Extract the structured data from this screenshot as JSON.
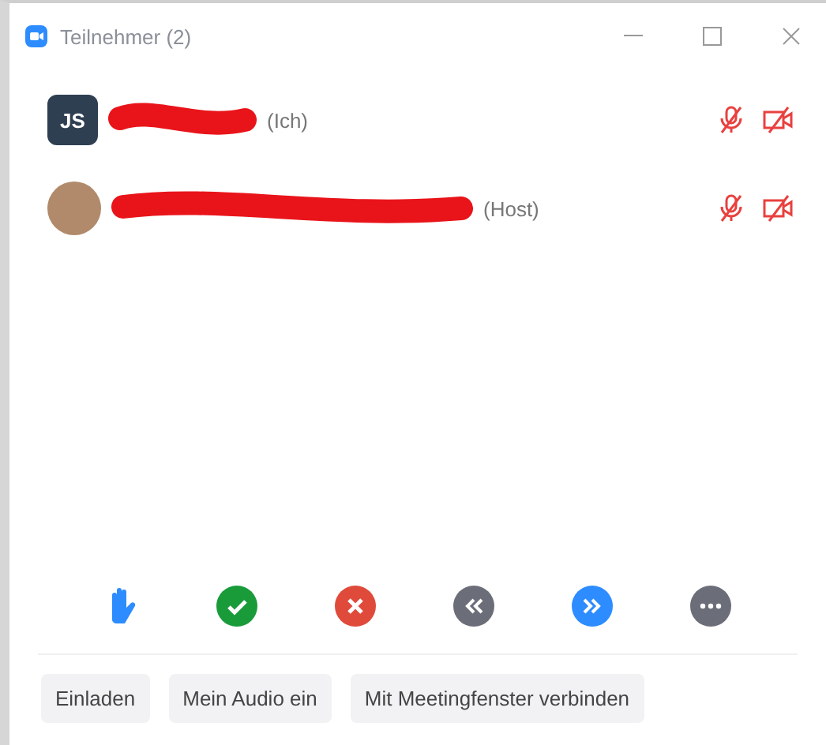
{
  "window": {
    "title": "Teilnehmer (2)"
  },
  "participants": [
    {
      "avatar": {
        "kind": "initials",
        "text": "JS"
      },
      "tag": "(Ich)",
      "redaction": {
        "kind": "short"
      },
      "audio_muted": true,
      "video_off": true
    },
    {
      "avatar": {
        "kind": "photo"
      },
      "tag": "(Host)",
      "redaction": {
        "kind": "long"
      },
      "audio_muted": true,
      "video_off": true
    }
  ],
  "reactions": [
    {
      "kind": "raise-hand"
    },
    {
      "kind": "yes"
    },
    {
      "kind": "no"
    },
    {
      "kind": "slower"
    },
    {
      "kind": "faster"
    },
    {
      "kind": "more"
    }
  ],
  "buttons": [
    "Einladen",
    "Mein Audio ein",
    "Mit Meetingfenster verbinden"
  ]
}
